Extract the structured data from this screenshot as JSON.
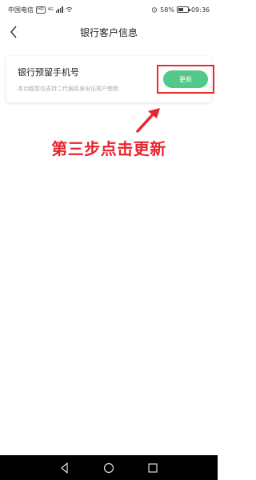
{
  "status_bar": {
    "carrier": "中国电信",
    "network_badge": "HD",
    "network_type": "4G",
    "battery_percent": "58%",
    "battery_level": 0.58,
    "time": "09:36"
  },
  "header": {
    "back_icon": "chevron-left",
    "title": "银行客户信息"
  },
  "card": {
    "title": "银行预留手机号",
    "note": "本功能暂仅支持二代居民身份证客户使用",
    "update_label": "更新",
    "button_color": "#52c98a"
  },
  "annotation": {
    "text": "第三步点击更新",
    "color": "#e6262d"
  },
  "system_nav": {
    "icons": [
      "back-triangle",
      "home-circle",
      "recents-square"
    ]
  }
}
